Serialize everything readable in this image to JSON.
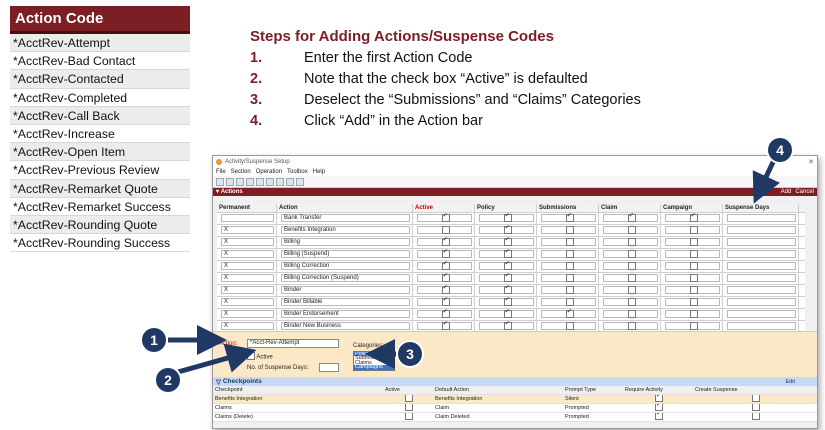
{
  "codes": {
    "header": "Action Code",
    "items": [
      "*AcctRev-Attempt",
      "*AcctRev-Bad Contact",
      "*AcctRev-Contacted",
      "*AcctRev-Completed",
      "*AcctRev-Call Back",
      "*AcctRev-Increase",
      "*AcctRev-Open Item",
      "*AcctRev-Previous Review",
      "*AcctRev-Remarket Quote",
      "*AcctRev-Remarket Success",
      "*AcctRev-Rounding Quote",
      "*AcctRev-Rounding Success"
    ]
  },
  "steps": {
    "title": "Steps for Adding Actions/Suspense Codes",
    "items": [
      {
        "num": "1.",
        "text": "Enter the first Action Code"
      },
      {
        "num": "2.",
        "text": "Note that the check box “Active” is defaulted"
      },
      {
        "num": "3.",
        "text": "Deselect the “Submissions” and “Claims” Categories"
      },
      {
        "num": "4.",
        "text": "Click “Add” in the Action bar"
      }
    ]
  },
  "window": {
    "title": "Activity/Suspense Setup",
    "menu": [
      "File",
      "Section",
      "Operation",
      "Toolbox",
      "Help"
    ],
    "actions_bar": {
      "label": "Actions",
      "add": "Add",
      "cancel": "Cancel"
    },
    "columns": [
      "Permanent",
      "Action",
      "Active",
      "Policy",
      "Submissions",
      "Claim",
      "Campaign",
      "Suspense Days"
    ],
    "rows": [
      {
        "perm": "",
        "action": "Bank Transfer",
        "checks": [
          true,
          true,
          true,
          true,
          true
        ]
      },
      {
        "perm": "X",
        "action": "Benefits Integration",
        "checks": [
          false,
          true,
          false,
          false,
          false
        ]
      },
      {
        "perm": "X",
        "action": "Billing",
        "checks": [
          true,
          true,
          false,
          false,
          false
        ]
      },
      {
        "perm": "X",
        "action": "Billing (Suspend)",
        "checks": [
          true,
          true,
          false,
          false,
          false
        ]
      },
      {
        "perm": "X",
        "action": "Billing Correction",
        "checks": [
          true,
          true,
          false,
          false,
          false
        ]
      },
      {
        "perm": "X",
        "action": "Billing Correction (Suspend)",
        "checks": [
          true,
          true,
          false,
          false,
          false
        ]
      },
      {
        "perm": "X",
        "action": "Binder",
        "checks": [
          true,
          true,
          false,
          false,
          false
        ]
      },
      {
        "perm": "X",
        "action": "Binder Billable",
        "checks": [
          true,
          true,
          false,
          false,
          false
        ]
      },
      {
        "perm": "X",
        "action": "Binder Endorsement",
        "checks": [
          true,
          true,
          true,
          false,
          false
        ]
      },
      {
        "perm": "X",
        "action": "Binder New Business",
        "checks": [
          true,
          true,
          false,
          false,
          false
        ]
      }
    ],
    "form": {
      "action_label": "Action:",
      "action_value": "*Acct-Rev-Attempt",
      "active_label": "Active",
      "suspense_label": "No. of Suspense Days:",
      "categories_label": "Categories:",
      "categories": [
        {
          "label": "Policy",
          "selected": true
        },
        {
          "label": "Submissions",
          "selected": false
        },
        {
          "label": "Claims",
          "selected": false
        },
        {
          "label": "Campaigns",
          "selected": true
        }
      ]
    },
    "checkpoints": {
      "label": "Checkpoints",
      "edit": "Edit",
      "columns": [
        "Checkpoint",
        "Active",
        "Default Action",
        "Prompt Type",
        "Require Activity",
        "Create Suspense"
      ],
      "rows": [
        {
          "checkpoint": "Benefits Integration",
          "default_action": "Benefits Integration",
          "prompt": "Silent",
          "require": true
        },
        {
          "checkpoint": "Claims",
          "default_action": "Claim",
          "prompt": "Prompted",
          "require": true
        },
        {
          "checkpoint": "Claims (Delete)",
          "default_action": "Claim Deleted",
          "prompt": "Prompted",
          "require": true
        }
      ]
    }
  },
  "callouts": [
    "1",
    "2",
    "3",
    "4"
  ],
  "colors": {
    "brand": "#7b1f24",
    "callout": "#1f3864",
    "form_bg": "#fbe8c7"
  }
}
